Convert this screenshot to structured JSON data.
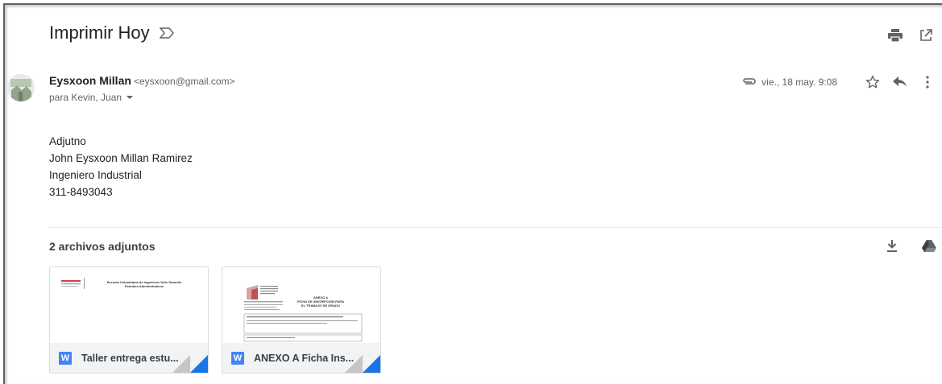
{
  "email": {
    "subject": "Imprimir Hoy",
    "sender_name": "Eysxoon Millan",
    "sender_email": "<eysxoon@gmail.com>",
    "recipients": "para Kevin, Juan",
    "date": "vie., 18 may. 9:08",
    "body": [
      "Adjutno",
      "John Eysxoon Millan Ramirez",
      "Ingeniero Industrial",
      "311-8493043"
    ]
  },
  "attachments": {
    "title": "2 archivos adjuntos",
    "files": [
      {
        "name": "Taller entrega estu...",
        "type_letter": "W",
        "preview_heading": "Escuela Colombiana de Ingeniería Julio Garavito",
        "preview_sub": "Estudios Administrativos"
      },
      {
        "name": "ANEXO A Ficha Ins...",
        "type_letter": "W",
        "preview_heading": "ANEXO A",
        "preview_sub": "FICHA DE INSCRIPCIÓN PARA EL TRABAJO DE GRADO"
      }
    ]
  },
  "icons": {
    "important": "important-marker-icon",
    "print": "print-icon",
    "open_new": "open-in-new-window-icon",
    "attachment": "paperclip-icon",
    "star": "star-icon",
    "reply": "reply-icon",
    "more": "more-vert-icon",
    "download": "download-icon",
    "drive": "google-drive-icon"
  },
  "colors": {
    "word_blue": "#4285f4",
    "corner_blue": "#1a73e8",
    "text": "#202124",
    "muted": "#5f6368"
  }
}
